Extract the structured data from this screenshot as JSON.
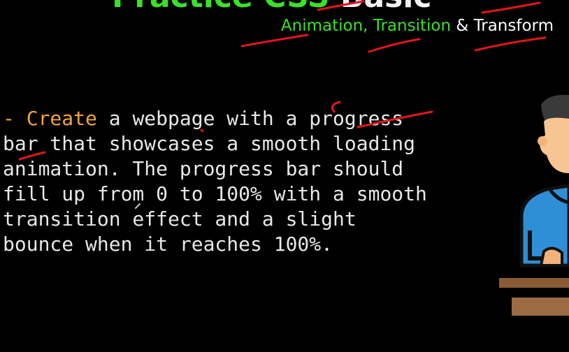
{
  "header": {
    "title_green": "Practice CSS ",
    "title_white": "Basic",
    "subtitle_green": "Animation, Transition",
    "subtitle_white": " & Transform"
  },
  "task": {
    "bullet": "- ",
    "keyword": "Create",
    "line1_rest": " a webpage with a progress",
    "line2": "bar that showcases a smooth loading",
    "line3": "animation. The progress bar should",
    "line4": "fill up from 0 to 100% with a smooth",
    "line5": "transition effect and a slight",
    "line6": "bounce when it reaches 100%."
  },
  "colors": {
    "background": "#000000",
    "green": "#3be02a",
    "orange": "#f0a33c",
    "text": "#e8e8e8",
    "annotation_red": "#e0161a",
    "shirt_blue": "#2f8fd6",
    "desk_brown": "#8b5a36"
  }
}
